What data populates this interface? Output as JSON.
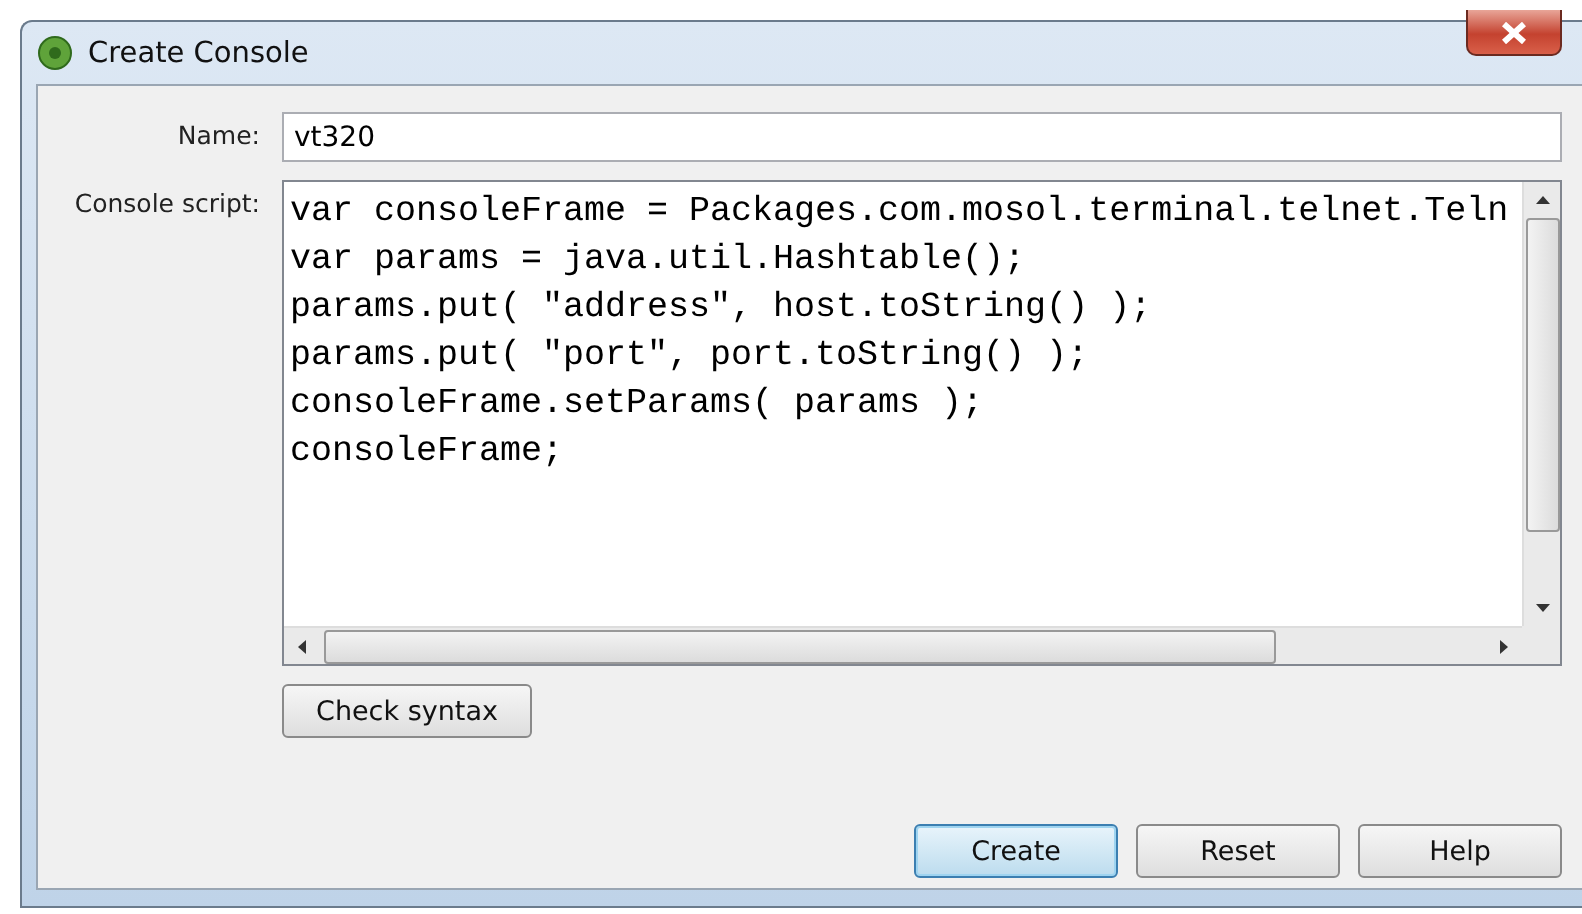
{
  "window": {
    "title": "Create Console"
  },
  "form": {
    "name_label": "Name:",
    "name_value": "vt320",
    "script_label": "Console script:",
    "script_lines": [
      "var consoleFrame = Packages.com.mosol.terminal.telnet.Teln",
      "var params = java.util.Hashtable();",
      "params.put( \"address\", host.toString() );",
      "params.put( \"port\", port.toString() );",
      "consoleFrame.setParams( params );",
      "consoleFrame;"
    ],
    "check_button": "Check syntax"
  },
  "buttons": [
    {
      "label": "Create",
      "default": true
    },
    {
      "label": "Reset",
      "default": false
    },
    {
      "label": "Help",
      "default": false
    }
  ]
}
